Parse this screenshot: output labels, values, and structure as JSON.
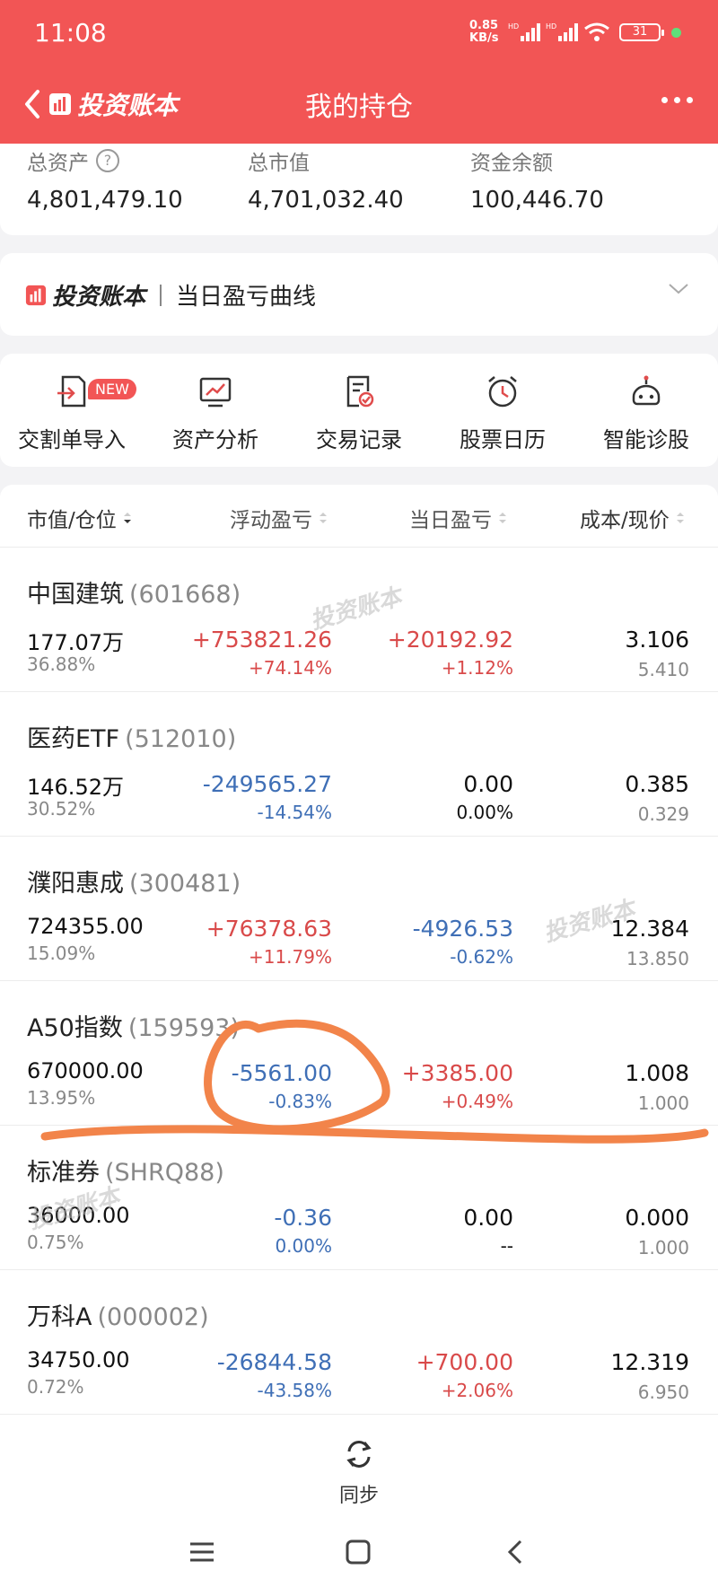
{
  "status_bar": {
    "time": "11:08",
    "net_speed": "0.85",
    "net_unit": "KB/s",
    "battery": "31"
  },
  "header": {
    "brand": "投资账本",
    "title": "我的持仓",
    "bg_color": "#f25555"
  },
  "summary": {
    "total_assets_label": "总资产",
    "total_assets": "4,801,479.10",
    "market_value_label": "总市值",
    "market_value": "4,701,032.40",
    "cash_label": "资金余额",
    "cash": "100,446.70"
  },
  "curve_card": {
    "brand": "投资账本",
    "label": "当日盈亏曲线"
  },
  "tools": [
    {
      "label": "交割单导入",
      "icon": "import-icon",
      "badge": "NEW"
    },
    {
      "label": "资产分析",
      "icon": "chart-monitor-icon"
    },
    {
      "label": "交易记录",
      "icon": "record-check-icon"
    },
    {
      "label": "股票日历",
      "icon": "alarm-clock-icon"
    },
    {
      "label": "智能诊股",
      "icon": "robot-icon"
    }
  ],
  "table_header": {
    "col1": "市值/仓位",
    "col2": "浮动盈亏",
    "col3": "当日盈亏",
    "col4": "成本/现价"
  },
  "holdings": [
    {
      "name": "中国建筑",
      "code": "(601668)",
      "market_value": "177.07万",
      "position": "36.88%",
      "float_pl": "+753821.26",
      "float_pl_pct": "+74.14%",
      "day_pl": "+20192.92",
      "day_pl_pct": "+1.12%",
      "cost": "3.106",
      "price": "5.410"
    },
    {
      "name": "医药ETF",
      "code": "(512010)",
      "market_value": "146.52万",
      "position": "30.52%",
      "float_pl": "-249565.27",
      "float_pl_pct": "-14.54%",
      "day_pl": "0.00",
      "day_pl_pct": "0.00%",
      "cost": "0.385",
      "price": "0.329"
    },
    {
      "name": "濮阳惠成",
      "code": "(300481)",
      "market_value": "724355.00",
      "position": "15.09%",
      "float_pl": "+76378.63",
      "float_pl_pct": "+11.79%",
      "day_pl": "-4926.53",
      "day_pl_pct": "-0.62%",
      "cost": "12.384",
      "price": "13.850"
    },
    {
      "name": "A50指数",
      "code": "(159593)",
      "market_value": "670000.00",
      "position": "13.95%",
      "float_pl": "-5561.00",
      "float_pl_pct": "-0.83%",
      "day_pl": "+3385.00",
      "day_pl_pct": "+0.49%",
      "cost": "1.008",
      "price": "1.000"
    },
    {
      "name": "标准券",
      "code": "(SHRQ88)",
      "market_value": "36000.00",
      "position": "0.75%",
      "float_pl": "-0.36",
      "float_pl_pct": "0.00%",
      "day_pl": "0.00",
      "day_pl_pct": "--",
      "cost": "0.000",
      "price": "1.000"
    },
    {
      "name": "万科A",
      "code": "(000002)",
      "market_value": "34750.00",
      "position": "0.72%",
      "float_pl": "-26844.58",
      "float_pl_pct": "-43.58%",
      "day_pl": "+700.00",
      "day_pl_pct": "+2.06%",
      "cost": "12.319",
      "price": "6.950"
    }
  ],
  "watermark": "投资账本",
  "sync_label": "同步",
  "colors": {
    "gain": "#d94a4a",
    "loss": "#3f6fb6",
    "annotation": "#f2844a"
  }
}
